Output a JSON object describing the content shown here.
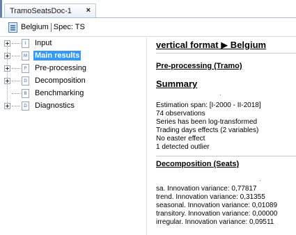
{
  "tab": {
    "title": "TramoSeatsDoc-1",
    "close": "×"
  },
  "toolbar": {
    "country": "Belgium",
    "spec": "Spec: TS"
  },
  "tree": {
    "items": [
      {
        "label": "Input",
        "icon": "I",
        "expandable": true,
        "selected": false
      },
      {
        "label": "Main results",
        "icon": "M",
        "expandable": true,
        "selected": true
      },
      {
        "label": "Pre-processing",
        "icon": "P",
        "expandable": true,
        "selected": false
      },
      {
        "label": "Decomposition",
        "icon": "D",
        "expandable": true,
        "selected": false
      },
      {
        "label": "Benchmarking",
        "icon": "B",
        "expandable": false,
        "selected": false
      },
      {
        "label": "Diagnostics",
        "icon": "D",
        "expandable": true,
        "selected": false
      }
    ]
  },
  "report": {
    "title": "vertical format ▶ Belgium",
    "preprocessing_heading": "Pre-processing (Tramo)",
    "summary_heading": "Summary",
    "summary_lines": [
      "Estimation span: [I-2000 - II-2018]",
      "74 observations",
      "Series has been log-transformed",
      "Trading days effects (2 variables)",
      "No easter effect",
      "1 detected outlier"
    ],
    "decomposition_heading": "Decomposition (Seats)",
    "variance_lines": [
      "sa. Innovation variance: 0,77817",
      "trend. Innovation variance: 0,31355",
      "seasonal. Innovation variance: 0,01089",
      "transitory. Innovation variance: 0,00000",
      "irregular. Innovation variance: 0,09511"
    ]
  }
}
